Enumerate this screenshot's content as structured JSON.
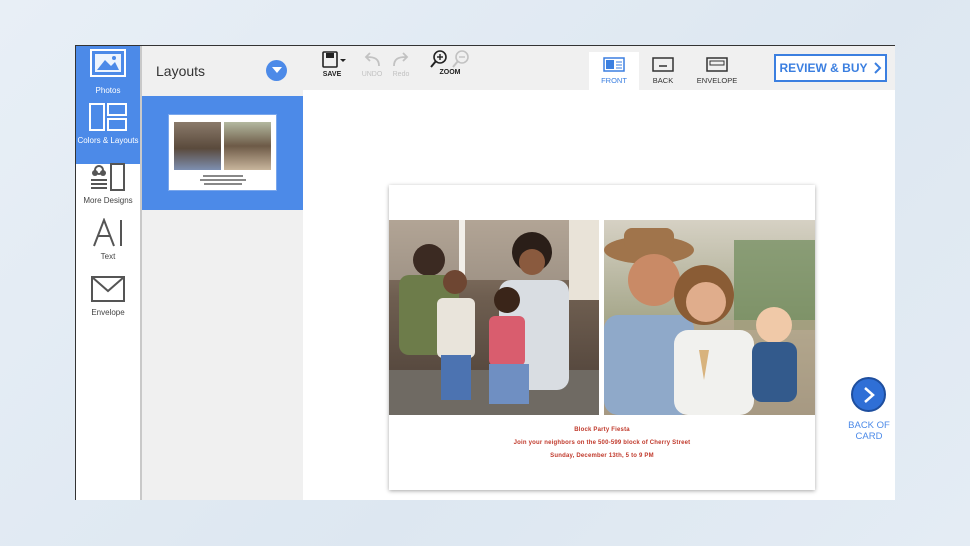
{
  "rail": {
    "items": [
      {
        "label": "Photos",
        "icon": "photos-icon"
      },
      {
        "label": "Colors & Layouts",
        "icon": "layouts-icon"
      },
      {
        "label": "More Designs",
        "icon": "more-designs-icon"
      },
      {
        "label": "Text",
        "icon": "text-icon"
      },
      {
        "label": "Envelope",
        "icon": "envelope-icon"
      }
    ]
  },
  "panel": {
    "title": "Layouts"
  },
  "toolbar": {
    "save": "SAVE",
    "undo": "UNDO",
    "redo": "Redo",
    "zoom": "ZOOM"
  },
  "tabs": [
    {
      "label": "FRONT",
      "active": true
    },
    {
      "label": "BACK",
      "active": false
    },
    {
      "label": "ENVELOPE",
      "active": false
    }
  ],
  "review_button": "REVIEW & BUY",
  "card": {
    "line1": "Block Party Fiesta",
    "line2": "Join your neighbors on the 500-599 block of Cherry Street",
    "line3": "Sunday, December 13th, 5 to 9 PM"
  },
  "next": {
    "line1": "BACK OF",
    "line2": "CARD"
  },
  "colors": {
    "accent": "#4c8ae8",
    "card_text": "#c0392b"
  }
}
